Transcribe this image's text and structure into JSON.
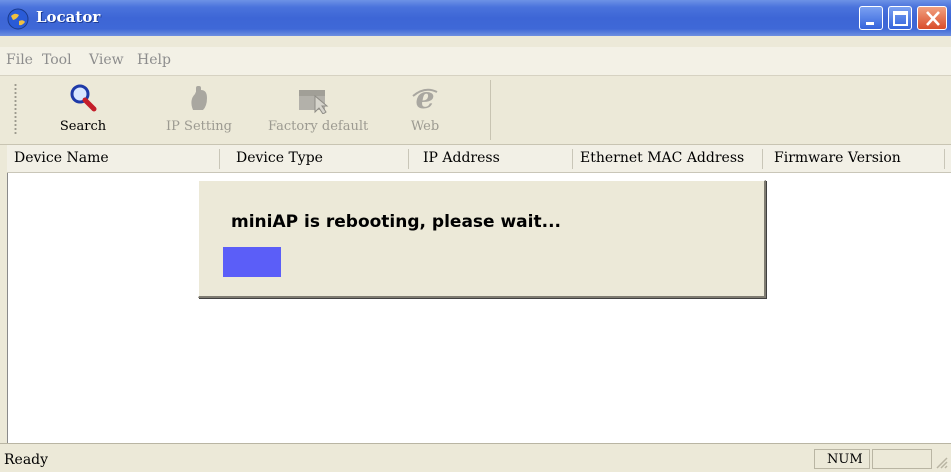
{
  "window": {
    "title": "Locator"
  },
  "menu": [
    "File",
    "Tool",
    "View",
    "Help"
  ],
  "toolbar": {
    "buttons": [
      {
        "label": "Search",
        "icon": "search-icon",
        "enabled": true
      },
      {
        "label": "IP Setting",
        "icon": "ip-setting-icon",
        "enabled": false
      },
      {
        "label": "Factory default",
        "icon": "factory-default-icon",
        "enabled": false
      },
      {
        "label": "Web",
        "icon": "web-icon",
        "enabled": false
      }
    ]
  },
  "table": {
    "columns": [
      "Device Name",
      "Device Type",
      "IP Address",
      "Ethernet MAC Address",
      "Firmware Version"
    ],
    "rows": []
  },
  "dialog": {
    "message": "miniAP is rebooting, please wait...",
    "progress_fraction": 0.18
  },
  "statusbar": {
    "text": "Ready",
    "indicator": "NUM"
  },
  "colors": {
    "titlebar": "#3d66d6",
    "window_bg": "#ece9d8",
    "progress_fill": "#5b5ef8",
    "close_button": "#d94d2a"
  }
}
